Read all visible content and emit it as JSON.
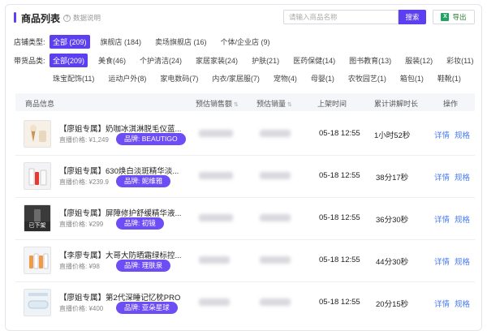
{
  "header": {
    "title": "商品列表",
    "help_text": "数据说明",
    "search_placeholder": "请输入商品名称",
    "search_button": "搜索",
    "export_button": "导出"
  },
  "filters": {
    "shop_type_label": "店铺类型:",
    "shop_types": [
      "全部 (209)",
      "旗舰店 (184)",
      "卖场旗舰店 (16)",
      "个体/企业店 (9)"
    ],
    "category_label": "带货品类:",
    "categories_row1": [
      "全部(209)",
      "美食(46)",
      "个护清洁(24)",
      "家居家装(24)",
      "护肤(21)",
      "医药保健(14)",
      "图书教育(13)",
      "服装(12)",
      "彩妆(11)"
    ],
    "categories_row2": [
      "珠宝配饰(11)",
      "运动户外(8)",
      "家电数码(7)",
      "内衣/家居服(7)",
      "宠物(4)",
      "母婴(1)",
      "农牧园艺(1)",
      "箱包(1)",
      "鞋靴(1)"
    ]
  },
  "table": {
    "columns": [
      "商品信息",
      "预估销售额",
      "预估销量",
      "上架时间",
      "累计讲解时长",
      "操作"
    ],
    "rows": [
      {
        "name": "【廖姐专属】奶咖冰淇淋脱毛仪蓝...",
        "price_label": "直播价格: ¥1,249",
        "brand": "品牌: BEAUTIGO",
        "listed": "05-18 12:55",
        "duration": "1小时52秒",
        "off_shelf": ""
      },
      {
        "name": "【廖姐专属】630焕白淡斑精华淡...",
        "price_label": "直播价格: ¥239.9",
        "brand": "品牌: 妮维雅",
        "listed": "05-18 12:55",
        "duration": "38分17秒",
        "off_shelf": ""
      },
      {
        "name": "【廖姐专属】屏障修护舒缓精华液...",
        "price_label": "直播价格: ¥299",
        "brand": "品牌: 初镜",
        "listed": "05-18 12:55",
        "duration": "36分30秒",
        "off_shelf": "已下架"
      },
      {
        "name": "【李廖专属】大哥大防晒霜绿标控...",
        "price_label": "直播价格: ¥98",
        "brand": "品牌: 理肤泉",
        "listed": "05-18 12:55",
        "duration": "44分30秒",
        "off_shelf": ""
      },
      {
        "name": "【廖姐专属】第2代深睡记忆枕PRO",
        "price_label": "直播价格: ¥400",
        "brand": "品牌: 亚朵星球",
        "listed": "05-18 12:55",
        "duration": "20分15秒",
        "off_shelf": ""
      }
    ],
    "action_detail": "详情",
    "action_spec": "规格"
  },
  "colors": {
    "accent": "#5b3ff0",
    "brand_pill": "#6d4df5",
    "link": "#4a7cf0"
  }
}
